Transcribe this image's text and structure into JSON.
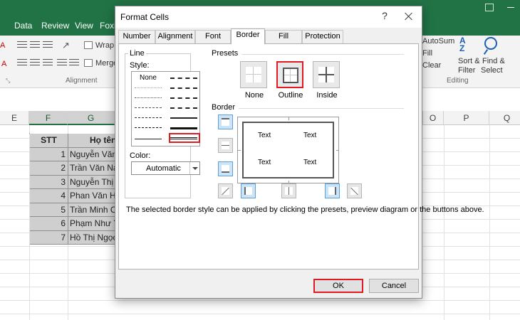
{
  "menu": [
    "Data",
    "Review",
    "View",
    "Foxit"
  ],
  "ribbon": {
    "wrap": "Wrap",
    "merge": "Merge",
    "alignment_group": "Alignment",
    "autosum": "AutoSum",
    "fill": "Fill",
    "clear": "Clear",
    "sort_filter": [
      "Sort &",
      "Filter"
    ],
    "find_select": [
      "Find &",
      "Select"
    ],
    "editing_group": "Editing"
  },
  "columns": [
    "E",
    "F",
    "G",
    "",
    "",
    "",
    "",
    "O",
    "P",
    "Q"
  ],
  "table": {
    "headers": [
      "STT",
      "Họ tên"
    ],
    "rows": [
      [
        "1",
        "Nguyễn Văn"
      ],
      [
        "2",
        "Trần Văn Na"
      ],
      [
        "3",
        "Nguyễn Thị T"
      ],
      [
        "4",
        "Phan Văn Hả"
      ],
      [
        "5",
        "Trần Minh C"
      ],
      [
        "6",
        "Phạm Như Ý"
      ],
      [
        "7",
        "Hồ Thị Ngọc"
      ]
    ]
  },
  "dialog": {
    "title": "Format Cells",
    "help": "?",
    "tabs": [
      "Number",
      "Alignment",
      "Font",
      "Border",
      "Fill",
      "Protection"
    ],
    "active_tab": "Border",
    "line_group": "Line",
    "style_label": "Style:",
    "style_none": "None",
    "color_label": "Color:",
    "color_value": "Automatic",
    "presets_group": "Presets",
    "presets": [
      "None",
      "Outline",
      "Inside"
    ],
    "selected_preset": "Outline",
    "border_group": "Border",
    "preview_text": [
      "Text",
      "Text",
      "Text",
      "Text"
    ],
    "info": "The selected border style can be applied by clicking the presets, preview diagram or the buttons above.",
    "ok": "OK",
    "cancel": "Cancel",
    "highlight_color": "#e21b23"
  }
}
